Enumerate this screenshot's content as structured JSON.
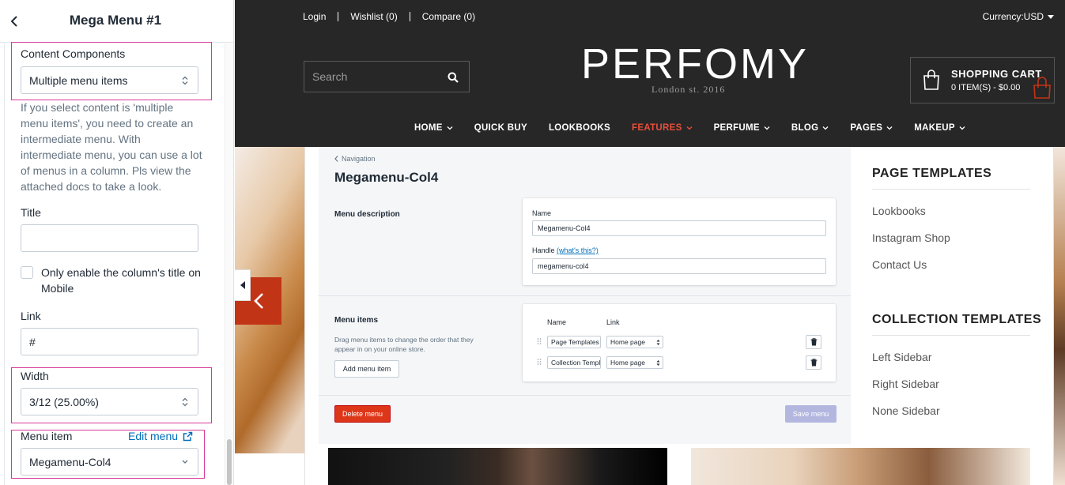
{
  "panel": {
    "title": "Mega Menu #1",
    "content_components": {
      "label": "Content Components",
      "value": "Multiple menu items"
    },
    "help_text": "If you select content is 'multiple menu items', you need to create an intermediate menu. With intermediate menu, you can use a lot of menus in a column. Pls view the attached docs to take a look.",
    "title_field": {
      "label": "Title",
      "value": ""
    },
    "mobile_checkbox": {
      "label": "Only enable the column's title on Mobile",
      "checked": false
    },
    "link_field": {
      "label": "Link",
      "value": "#"
    },
    "width_field": {
      "label": "Width",
      "value": "3/12 (25.00%)"
    },
    "menu_item": {
      "label": "Menu item",
      "edit_label": "Edit menu",
      "value": "Megamenu-Col4"
    }
  },
  "store": {
    "top_links": [
      "Login",
      "Wishlist (0)",
      "Compare (0)"
    ],
    "currency": "Currency:USD",
    "search_placeholder": "Search",
    "logo": "PERFOMY",
    "tagline": "London st. 2016",
    "cart": {
      "title": "SHOPPING CART",
      "summary": "0 ITEM(S) - $0.00"
    },
    "nav": [
      {
        "label": "HOME",
        "dropdown": true,
        "active": false
      },
      {
        "label": "QUICK BUY",
        "dropdown": false,
        "active": false
      },
      {
        "label": "LOOKBOOKS",
        "dropdown": false,
        "active": false
      },
      {
        "label": "FEATURES",
        "dropdown": true,
        "active": true
      },
      {
        "label": "PERFUME",
        "dropdown": true,
        "active": false
      },
      {
        "label": "BLOG",
        "dropdown": true,
        "active": false
      },
      {
        "label": "PAGES",
        "dropdown": true,
        "active": false
      },
      {
        "label": "MAKEUP",
        "dropdown": true,
        "active": false
      }
    ],
    "active_nav_color": "#e94e3b",
    "header_bg": "#272727"
  },
  "admin": {
    "breadcrumb": "Navigation",
    "title": "Megamenu-Col4",
    "menu_description_label": "Menu description",
    "name_label": "Name",
    "name_value": "Megamenu-Col4",
    "handle_label": "Handle",
    "handle_link": "(what's this?)",
    "handle_value": "megamenu-col4",
    "menu_items_label": "Menu items",
    "menu_items_help": "Drag menu items to change the order that they appear in on your online store.",
    "add_button": "Add menu item",
    "col_name": "Name",
    "col_link": "Link",
    "rows": [
      {
        "name": "Page Templates",
        "link": "Home page"
      },
      {
        "name": "Collection Templ",
        "link": "Home page"
      }
    ],
    "delete_button": "Delete menu",
    "save_button": "Save menu"
  },
  "templates": {
    "page_heading": "PAGE TEMPLATES",
    "page_links": [
      "Lookbooks",
      "Instagram Shop",
      "Contact Us"
    ],
    "collection_heading": "COLLECTION TEMPLATES",
    "collection_links": [
      "Left Sidebar",
      "Right Sidebar",
      "None Sidebar"
    ]
  },
  "colors": {
    "highlight": "#d63a98",
    "link": "#006fbb",
    "danger": "#de3618",
    "hero_button": "#c23416"
  }
}
